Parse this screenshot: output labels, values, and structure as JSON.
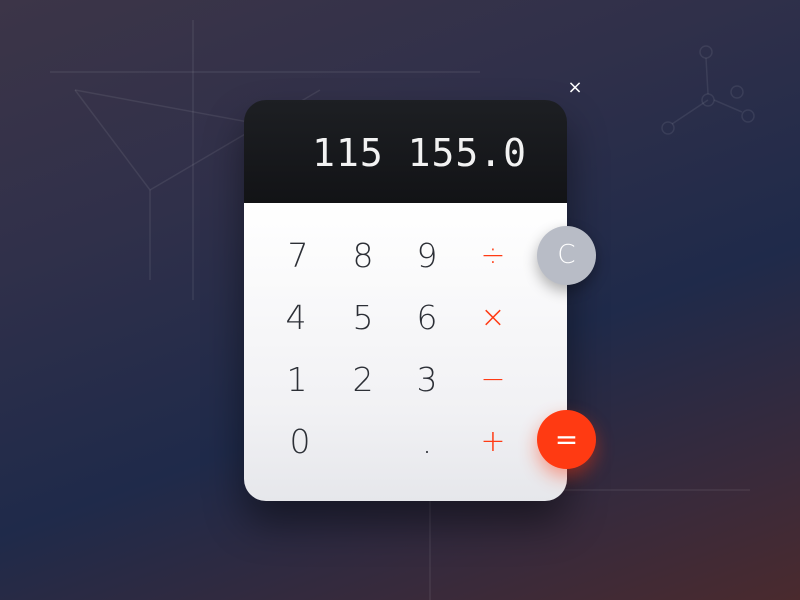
{
  "window": {
    "close_label": "×"
  },
  "display": {
    "value": "115 155.0"
  },
  "keypad": {
    "digits": {
      "d7": "7",
      "d8": "8",
      "d9": "9",
      "d4": "4",
      "d5": "5",
      "d6": "6",
      "d1": "1",
      "d2": "2",
      "d3": "3",
      "d0": "0",
      "decimal": "."
    },
    "operators": {
      "divide": "÷",
      "multiply": "×",
      "subtract": "−",
      "add": "+"
    }
  },
  "actions": {
    "clear_label": "C",
    "equals_label": "="
  },
  "colors": {
    "accent": "#ff3a12",
    "clear_button": "#b8bcc6",
    "display_bg": "#16171a",
    "keypad_bg": "#f4f4f6"
  }
}
